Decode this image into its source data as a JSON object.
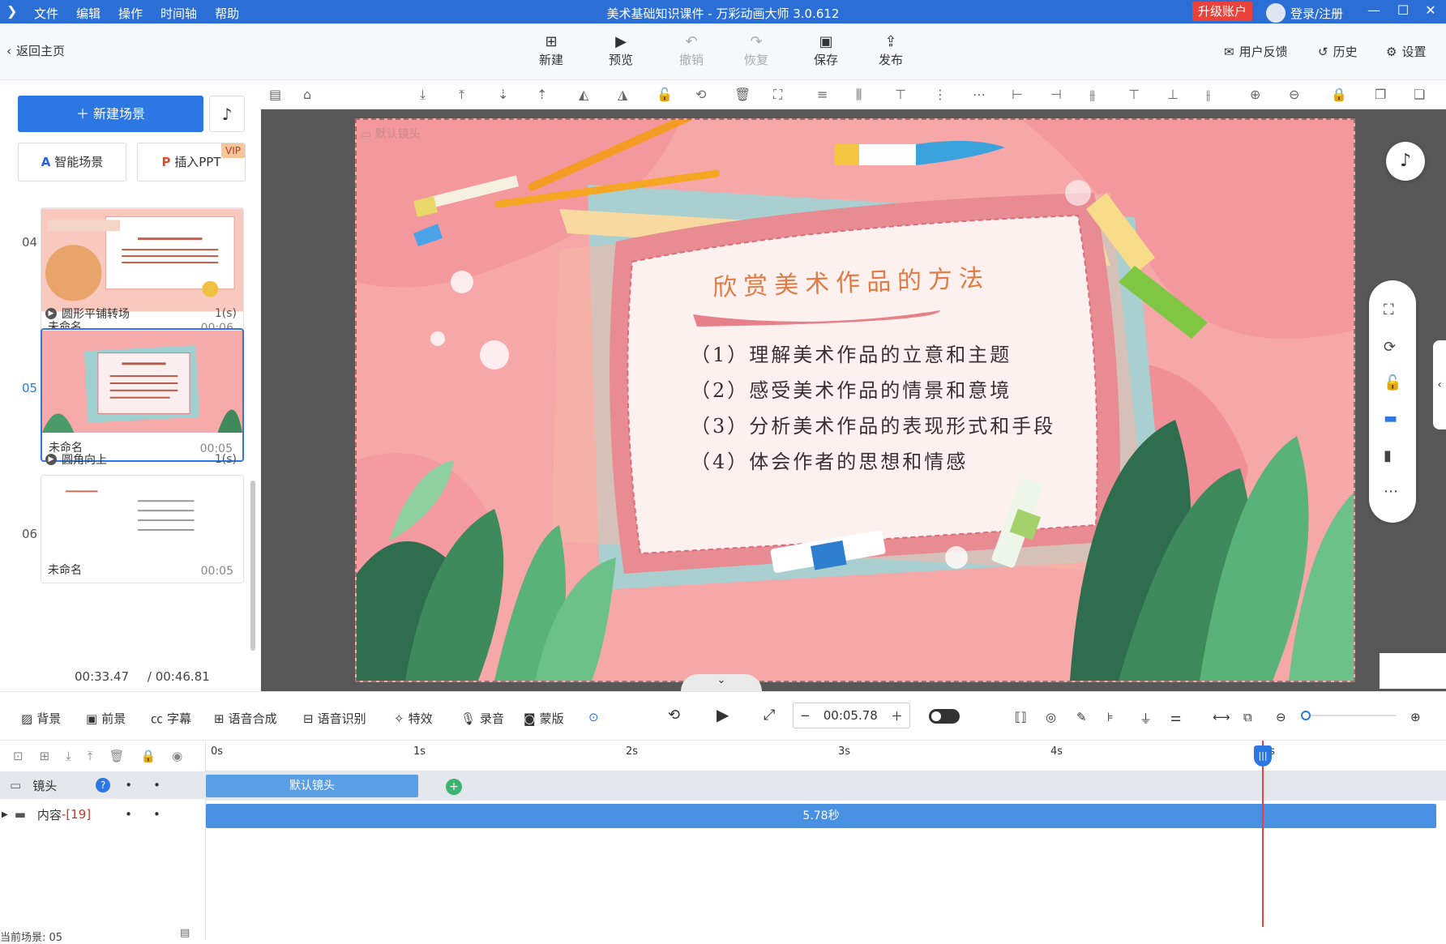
{
  "titlebar": {
    "menu": [
      "文件",
      "编辑",
      "操作",
      "时间轴",
      "帮助"
    ],
    "title": "美术基础知识课件 - 万彩动画大师 3.0.612",
    "upgrade": "升级账户",
    "login": "登录/注册"
  },
  "toolbar": {
    "back": "返回主页",
    "new": "新建",
    "preview": "预览",
    "undo": "撤销",
    "redo": "恢复",
    "save": "保存",
    "publish": "发布",
    "feedback": "用户反馈",
    "history": "历史",
    "settings": "设置"
  },
  "left": {
    "new_scene": "新建场景",
    "smart_scene": "智能场景",
    "insert_ppt": "插入PPT",
    "vip": "VIP",
    "scenes": [
      {
        "num": "04",
        "name": "未命名",
        "duration": "00:06",
        "transition": "圆形平铺转场",
        "trans_sec": "1(s)"
      },
      {
        "num": "05",
        "name": "未命名",
        "duration": "00:05",
        "transition": "圆角向上",
        "trans_sec": "1(s)"
      },
      {
        "num": "06",
        "name": "未命名",
        "duration": "00:05"
      }
    ],
    "current_time": "00:33.47",
    "total_time": "/ 00:46.81"
  },
  "canvas": {
    "camera_label": "默认镜头",
    "slide_title": "欣赏美术作品的方法",
    "items": [
      "（1）理解美术作品的立意和主题",
      "（2）感受美术作品的情景和意境",
      "（3）分析美术作品的表现形式和手段",
      "（4）体会作者的思想和情感"
    ]
  },
  "bottom": {
    "background": "背景",
    "foreground": "前景",
    "subtitle": "字幕",
    "tts": "语音合成",
    "asr": "语音识别",
    "effects": "特效",
    "record": "录音",
    "mask": "蒙版",
    "time": "00:05.78"
  },
  "timeline": {
    "ticks": [
      "0s",
      "1s",
      "2s",
      "3s",
      "4s",
      "5s"
    ],
    "camera_track": "镜头",
    "content_track": "内容",
    "content_count": "-[19]",
    "camera_clip": "默认镜头",
    "content_clip": "5.78秒",
    "current_scene": "当前场景: 05"
  }
}
